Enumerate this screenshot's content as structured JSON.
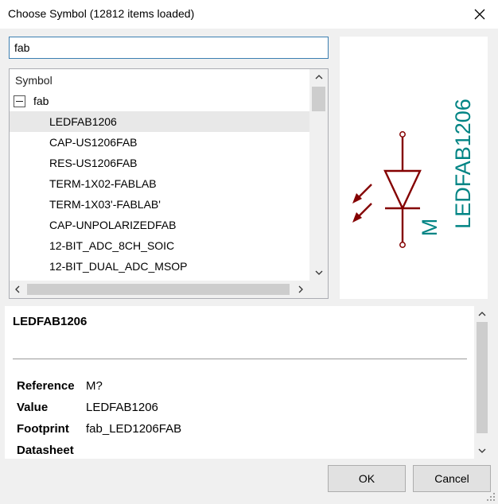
{
  "window": {
    "title": "Choose Symbol (12812 items loaded)",
    "close_icon": "close-icon"
  },
  "search": {
    "value": "fab"
  },
  "tree": {
    "header": "Symbol",
    "root": {
      "label": "fab",
      "expander_icon": "collapse-icon"
    },
    "items": [
      {
        "label": "LEDFAB1206"
      },
      {
        "label": "CAP-US1206FAB"
      },
      {
        "label": "RES-US1206FAB"
      },
      {
        "label": "TERM-1X02-FABLAB"
      },
      {
        "label": "TERM-1X03'-FABLAB'"
      },
      {
        "label": "CAP-UNPOLARIZEDFAB"
      },
      {
        "label": "12-BIT_ADC_8CH_SOIC"
      },
      {
        "label": "12-BIT_DUAL_ADC_MSOP"
      }
    ],
    "selected_index": 0
  },
  "preview": {
    "symbol_value": "LEDFAB1206",
    "symbol_reference": "M",
    "symbol_icon": "led-symbol-icon",
    "colors": {
      "body": "#840000",
      "text": "#008484"
    }
  },
  "info": {
    "name": "LEDFAB1206",
    "fields": [
      {
        "label": "Reference",
        "value": "M?"
      },
      {
        "label": "Value",
        "value": "LEDFAB1206"
      },
      {
        "label": "Footprint",
        "value": "fab_LED1206FAB"
      },
      {
        "label": "Datasheet",
        "value": ""
      }
    ]
  },
  "buttons": {
    "ok": "OK",
    "cancel": "Cancel"
  },
  "colors": {
    "focus_border": "#3c7fb1",
    "selection": "#e8e8e8",
    "button_face": "#e1e1e1"
  }
}
